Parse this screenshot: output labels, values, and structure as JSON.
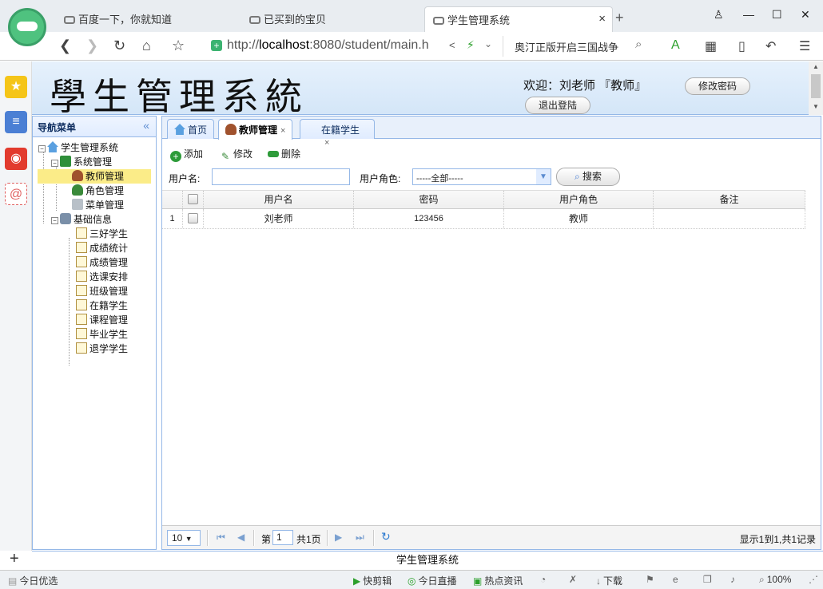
{
  "browser": {
    "tabs": [
      {
        "title": "百度一下，你就知道"
      },
      {
        "title": "已买到的宝贝"
      },
      {
        "title": "学生管理系统"
      }
    ],
    "url_prefix": "http://",
    "url_host": "localhost",
    "url_rest": ":8080/student/main.h",
    "search_text": "奥汀正版开启三国战争",
    "new_tab": "+",
    "close": "×"
  },
  "header": {
    "app_title": "學生管理系統",
    "welcome": "欢迎：刘老师 『教师』",
    "change_password": "修改密码",
    "logout": "退出登陆"
  },
  "nav": {
    "title": "导航菜单",
    "collapse": "«",
    "root": "学生管理系统",
    "groups": [
      {
        "label": "系统管理",
        "items": [
          "教师管理",
          "角色管理",
          "菜单管理"
        ]
      },
      {
        "label": "基础信息",
        "items": [
          "三好学生",
          "成绩统计",
          "成绩管理",
          "选课安排",
          "班级管理",
          "在籍学生",
          "课程管理",
          "毕业学生",
          "退学学生"
        ]
      }
    ]
  },
  "main": {
    "tabs": [
      {
        "label": "首页"
      },
      {
        "label": "教师管理"
      },
      {
        "label": "在籍学生"
      }
    ],
    "toolbar": {
      "add": "添加",
      "edit": "修改",
      "delete": "删除"
    },
    "search": {
      "username_label": "用户名:",
      "username_value": "",
      "role_label": "用户角色:",
      "role_value": "-----全部-----",
      "search_button": "搜索"
    },
    "grid": {
      "columns": [
        "用户名",
        "密码",
        "用户角色",
        "备注"
      ],
      "rows": [
        {
          "num": "1",
          "username": "刘老师",
          "password": "123456",
          "role": "教师",
          "note": ""
        }
      ]
    },
    "pager": {
      "page_size": "10",
      "page_prefix": "第",
      "page_num": "1",
      "page_total": "共1页",
      "info": "显示1到1,共1记录"
    }
  },
  "footer": {
    "text": "学生管理系统"
  },
  "statusbar": {
    "left": "今日优选",
    "items": [
      "快剪辑",
      "今日直播",
      "热点资讯",
      "下载",
      "100%"
    ]
  },
  "colors": {
    "accent_border": "#95b8e7",
    "selected_node": "#fbec88",
    "header_bg": "#d4e6f8"
  }
}
